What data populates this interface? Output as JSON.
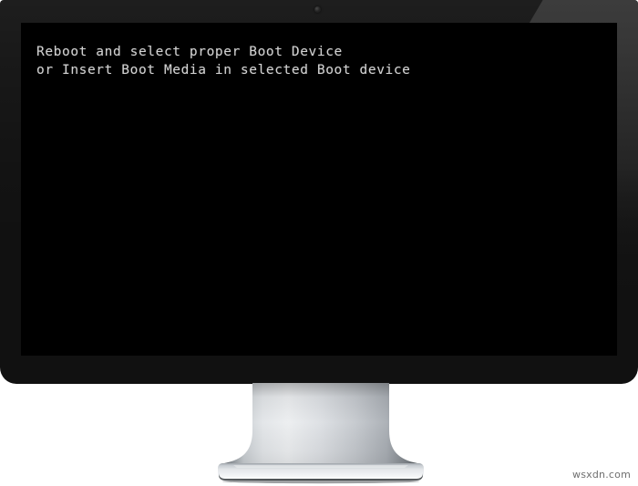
{
  "scene": {
    "device": "desktop-monitor",
    "background_color": "#ffffff"
  },
  "monitor": {
    "bezel_color": "#111111",
    "bezel_highlight_color": "#3c3c3c",
    "webcam_label": "webcam",
    "screen": {
      "background_color": "#000000",
      "text_color": "#d2d2d2",
      "message_lines": [
        "Reboot and select proper Boot Device",
        "or Insert Boot Media in selected Boot device"
      ],
      "message_block": "Reboot and select proper Boot Device\nor Insert Boot Media in selected Boot device"
    }
  },
  "stand": {
    "material": "brushed-aluminum",
    "highlight_color": "#e8eaec",
    "shadow_color": "#6e7378"
  },
  "watermark": {
    "text": "wsxdn.com",
    "color": "#6f6f6f"
  }
}
